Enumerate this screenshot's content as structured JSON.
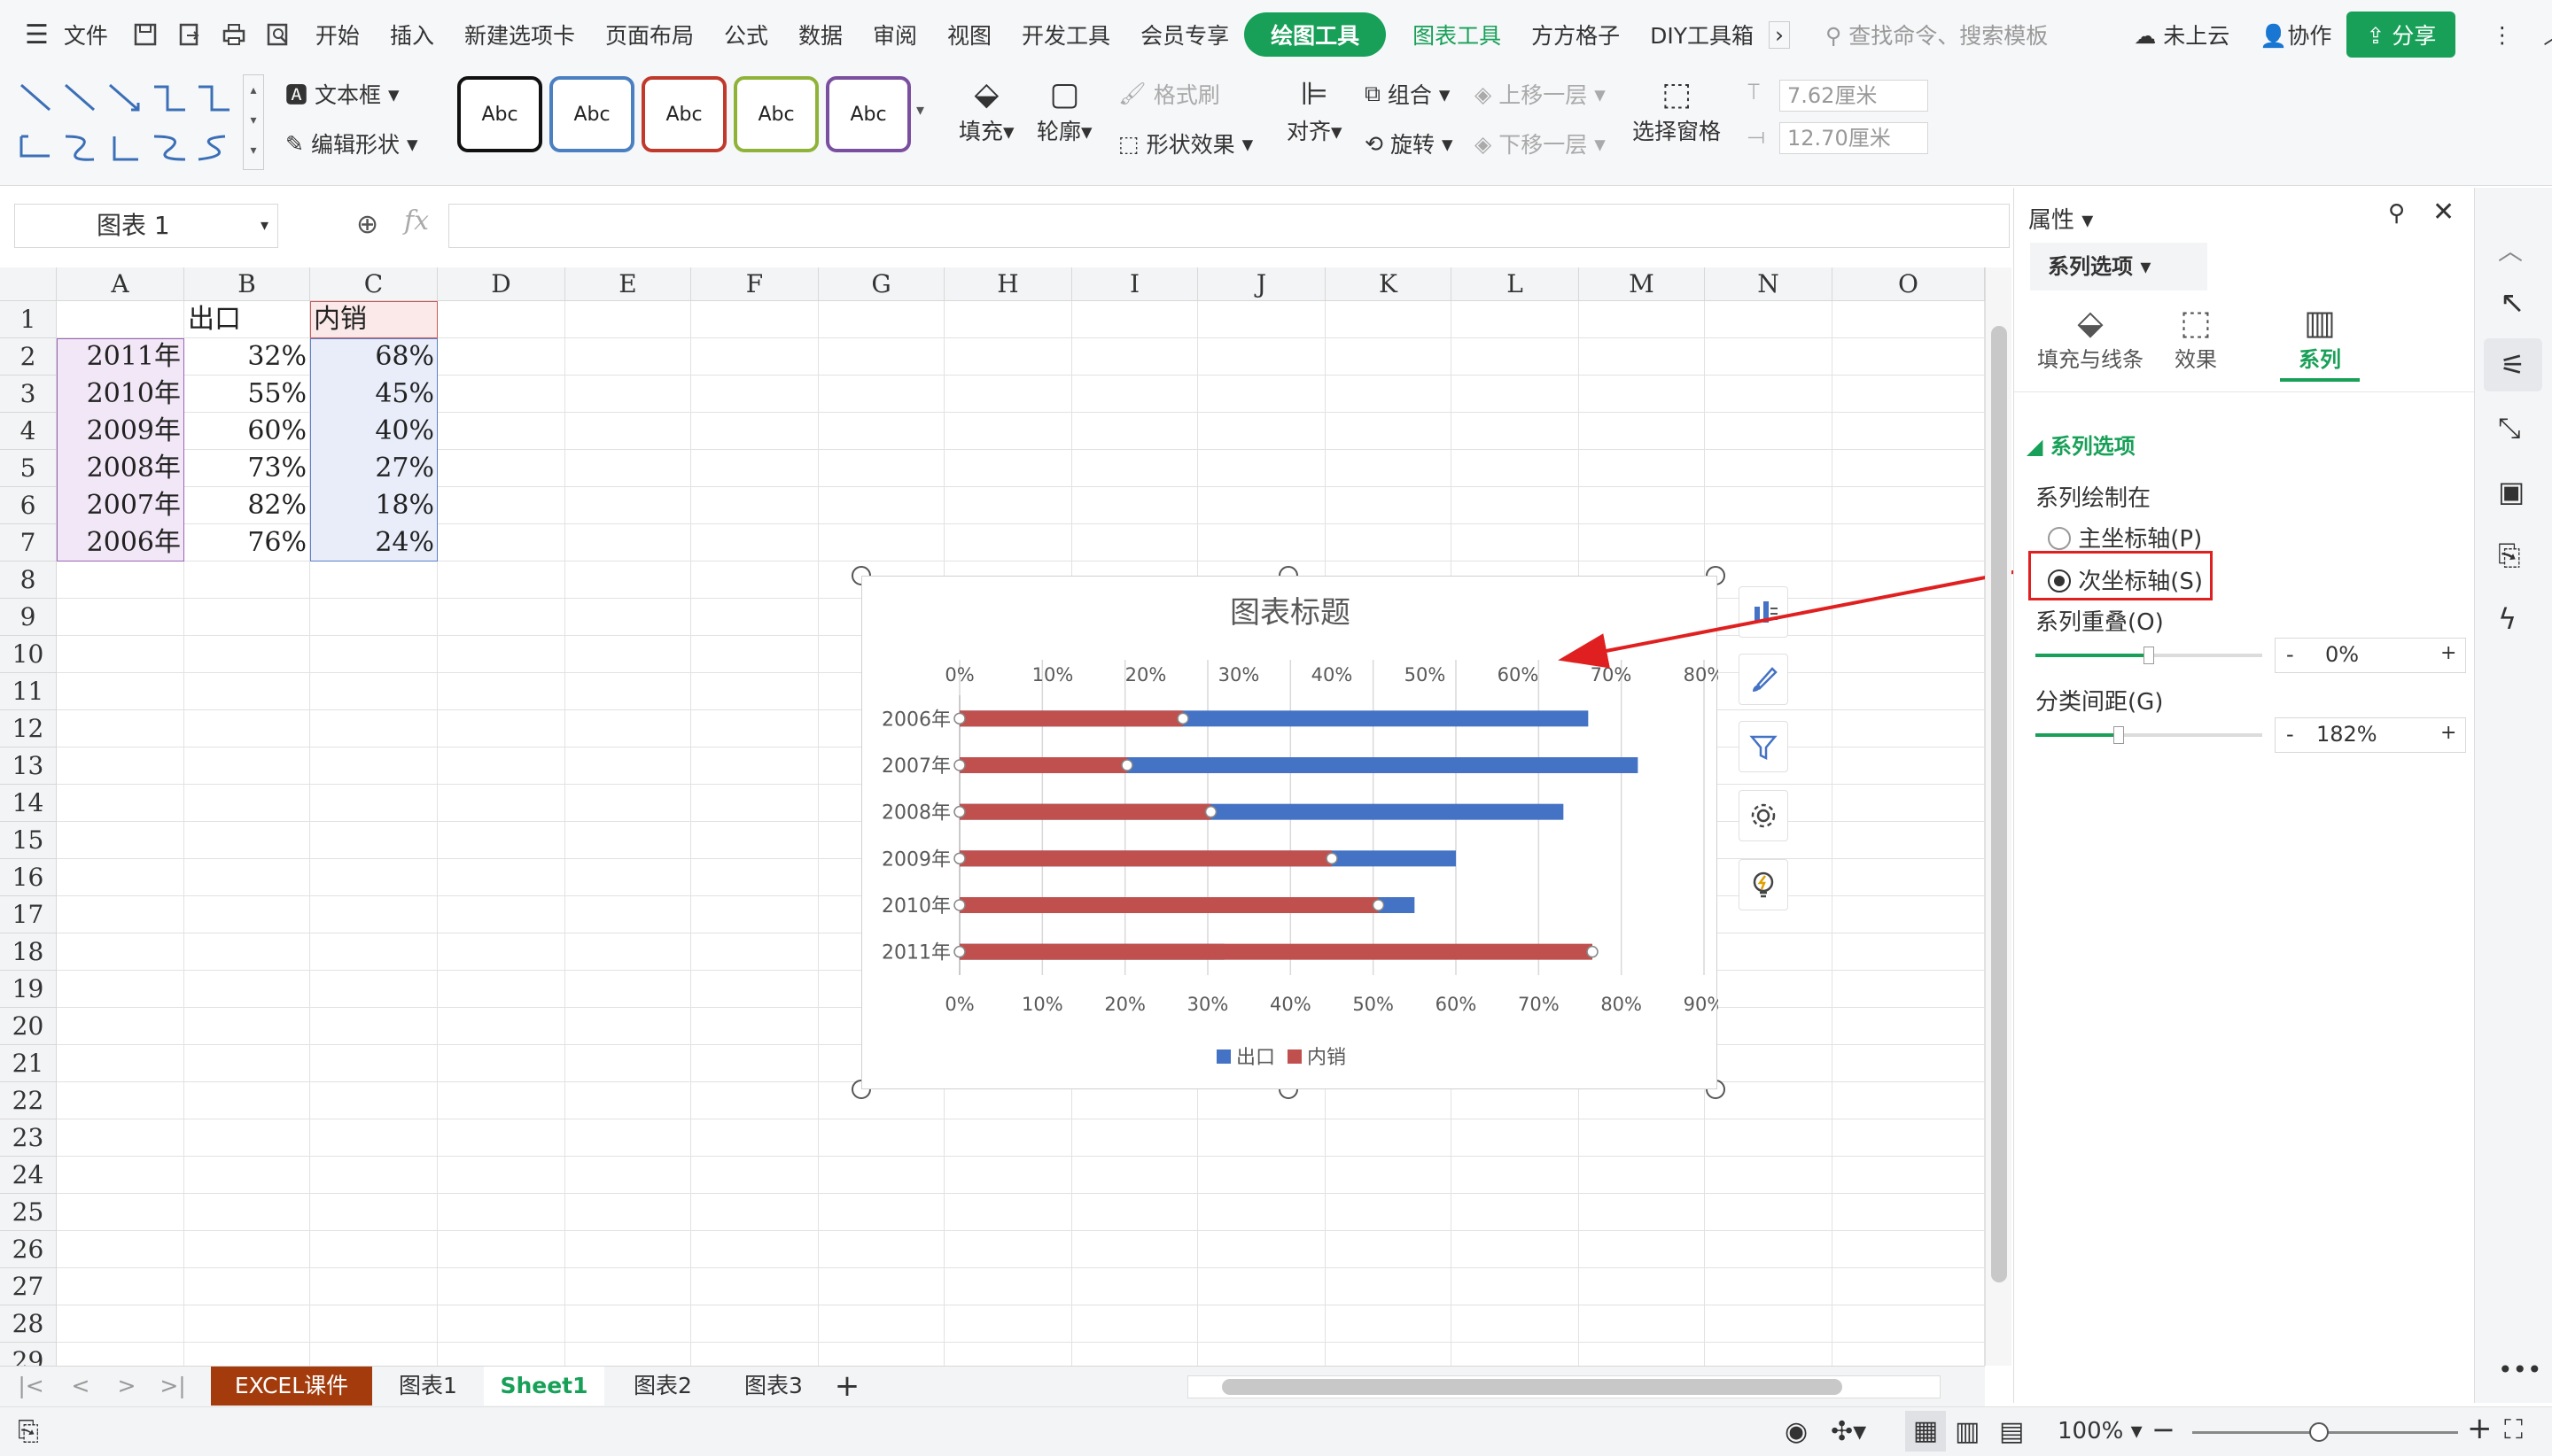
{
  "menu": {
    "file": "文件",
    "tabs": [
      "开始",
      "插入",
      "新建选项卡",
      "页面布局",
      "公式",
      "数据",
      "审阅",
      "视图",
      "开发工具",
      "会员专享"
    ],
    "drawing_tools": "绘图工具",
    "chart_tools": "图表工具",
    "tabs2": [
      "方方格子",
      "DIY工具箱"
    ],
    "search": "查找命令、搜索模板",
    "cloud": "未上云",
    "collab": "协作",
    "share": "分享"
  },
  "ribbon": {
    "textbox": "文本框",
    "edit_shape": "编辑形状",
    "style_label": "Abc",
    "style_colors": [
      "#111111",
      "#4a7fc1",
      "#c0392b",
      "#8fb339",
      "#7b4fa0"
    ],
    "fill": "填充",
    "outline": "轮廓",
    "format_painter": "格式刷",
    "shape_effects": "形状效果",
    "align": "对齐",
    "group": "组合",
    "rotate": "旋转",
    "bring_forward": "上移一层",
    "send_backward": "下移一层",
    "selection_pane": "选择窗格",
    "height": "7.62厘米",
    "width": "12.70厘米"
  },
  "formula": {
    "namebox": "图表 1",
    "fx": "fx"
  },
  "sheet": {
    "columns": [
      "A",
      "B",
      "C",
      "D",
      "E",
      "F",
      "G",
      "H",
      "I",
      "J",
      "K",
      "L",
      "M",
      "N",
      "O"
    ],
    "rows": [
      "1",
      "2",
      "3",
      "4",
      "5",
      "6",
      "7",
      "8",
      "9",
      "10",
      "11",
      "12",
      "13",
      "14",
      "15",
      "16",
      "17",
      "18",
      "19",
      "20",
      "21",
      "22",
      "23",
      "24",
      "25",
      "26",
      "27",
      "28",
      "29"
    ],
    "header_b": "出口",
    "header_c": "内销",
    "data": [
      [
        "2011年",
        "32%",
        "68%"
      ],
      [
        "2010年",
        "55%",
        "45%"
      ],
      [
        "2009年",
        "60%",
        "40%"
      ],
      [
        "2008年",
        "73%",
        "27%"
      ],
      [
        "2007年",
        "82%",
        "18%"
      ],
      [
        "2006年",
        "76%",
        "24%"
      ]
    ]
  },
  "chart_data": {
    "type": "bar",
    "title": "图表标题",
    "categories": [
      "2006年",
      "2007年",
      "2008年",
      "2009年",
      "2010年",
      "2011年"
    ],
    "series": [
      {
        "name": "出口",
        "values": [
          76,
          82,
          73,
          60,
          55,
          32
        ],
        "color": "#4472c4",
        "axis": "bottom"
      },
      {
        "name": "内销",
        "values": [
          24,
          18,
          27,
          40,
          45,
          68
        ],
        "color": "#c0504d",
        "axis": "top"
      }
    ],
    "top_ticks": [
      "0%",
      "10%",
      "20%",
      "30%",
      "40%",
      "50%",
      "60%",
      "70%",
      "80%"
    ],
    "bottom_ticks": [
      "0%",
      "10%",
      "20%",
      "30%",
      "40%",
      "50%",
      "60%",
      "70%",
      "80%",
      "90%"
    ],
    "top_range": [
      0,
      80
    ],
    "bottom_range": [
      0,
      90
    ],
    "legend_position": "bottom",
    "grid": true
  },
  "panel": {
    "title": "属性",
    "tab": "系列选项",
    "subtabs": [
      "填充与线条",
      "效果",
      "系列"
    ],
    "section": "系列选项",
    "plot_on": "系列绘制在",
    "primary": "主坐标轴(P)",
    "secondary": "次坐标轴(S)",
    "overlap_label": "系列重叠(O)",
    "overlap_value": "0%",
    "gap_label": "分类间距(G)",
    "gap_value": "182%",
    "minus": "-",
    "plus": "+"
  },
  "sheets": {
    "tabs": [
      "EXCEL课件",
      "图表1",
      "Sheet1",
      "图表2",
      "图表3"
    ],
    "add": "+"
  },
  "status": {
    "zoom": "100%",
    "minus": "−",
    "plus": "+"
  }
}
